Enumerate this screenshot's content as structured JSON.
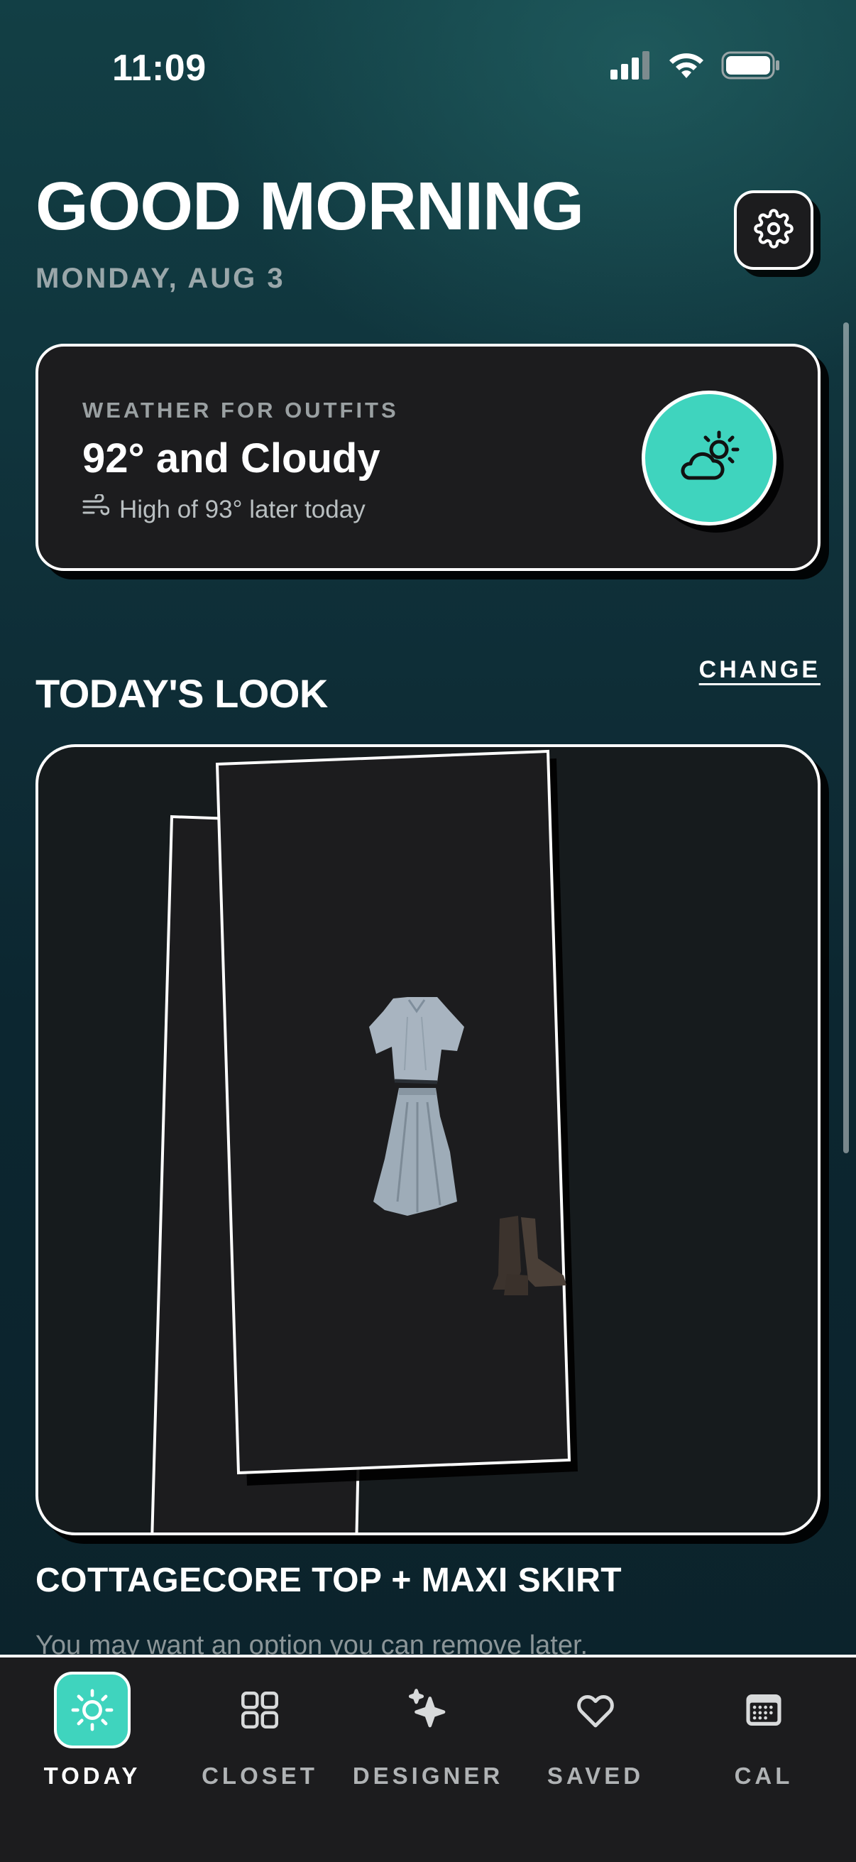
{
  "status_bar": {
    "time": "11:09",
    "icons": [
      "signal-icon",
      "wifi-icon",
      "battery-icon"
    ]
  },
  "header": {
    "greeting": "GOOD MORNING",
    "date": "MONDAY, AUG 3",
    "settings_icon": "gear-icon"
  },
  "weather": {
    "caption": "WEATHER FOR OUTFITS",
    "title": "92° and Cloudy",
    "subtitle": "High of 93° later today",
    "subtitle_icon": "wind-icon",
    "badge_icon": "partly-cloudy-icon",
    "badge_color": "#3fd4be"
  },
  "today_look": {
    "section_title": "TODAY'S LOOK",
    "change_label": "CHANGE",
    "items": [
      "blouse-image",
      "maxi-skirt-image",
      "boots-image"
    ],
    "outfit_name": "COTTAGECORE TOP + MAXI SKIRT",
    "description": "You may want an option you can remove later."
  },
  "tab_bar": {
    "tabs": [
      {
        "label": "TODAY",
        "icon": "sun-icon",
        "active": true
      },
      {
        "label": "CLOSET",
        "icon": "grid-icon",
        "active": false
      },
      {
        "label": "DESIGNER",
        "icon": "sparkles-icon",
        "active": false
      },
      {
        "label": "SAVED",
        "icon": "heart-icon",
        "active": false
      },
      {
        "label": "CAL",
        "icon": "calendar-icon",
        "active": false
      }
    ]
  },
  "colors": {
    "accent": "#3fd4be",
    "card": "#1c1c1e",
    "background": "#0f3039"
  }
}
